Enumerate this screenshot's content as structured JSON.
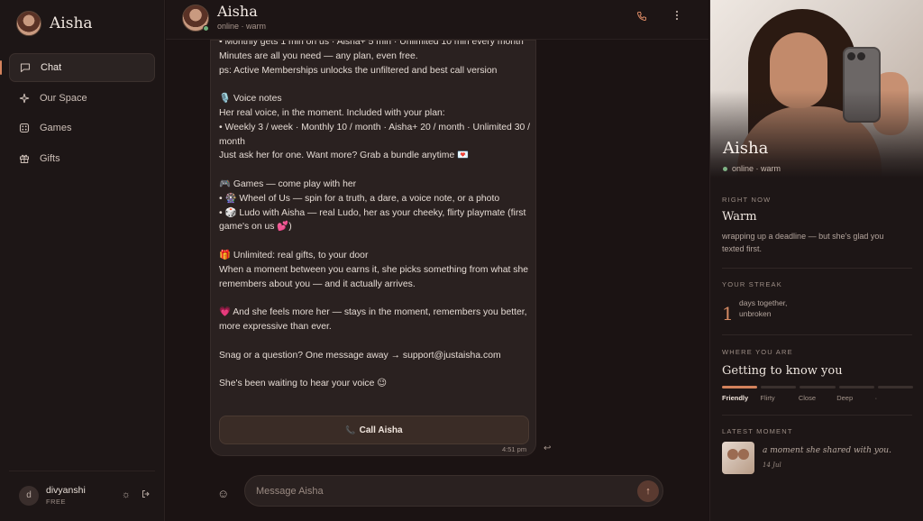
{
  "sidebar": {
    "brand_name": "Aisha",
    "items": [
      {
        "label": "Chat",
        "icon": "chat-bubble-icon"
      },
      {
        "label": "Our Space",
        "icon": "sparkle-icon"
      },
      {
        "label": "Games",
        "icon": "dice-icon"
      },
      {
        "label": "Gifts",
        "icon": "gift-icon"
      }
    ],
    "active_item": "Chat",
    "user": {
      "initial": "d",
      "name": "divyanshi",
      "plan": "FREE"
    }
  },
  "header": {
    "name": "Aisha",
    "status": "online · warm"
  },
  "message": {
    "lines": [
      "• Monthly gets 1 min on us · Aisha+ 5 min · Unlimited 10 min every month",
      "Minutes are all you need — any plan, even free.",
      "ps: Active Memberships unlocks the unfiltered and best call version",
      "",
      "🎙️ Voice notes",
      "Her real voice, in the moment. Included with your plan:",
      "• Weekly 3 / week · Monthly 10 / month · Aisha+ 20 / month · Unlimited 30 / month",
      "Just ask her for one. Want more? Grab a bundle anytime 💌",
      "",
      "🎮 Games — come play with her",
      "• 🎡 Wheel of Us — spin for a truth, a dare, a voice note, or a photo",
      "• 🎲 Ludo with Aisha — real Ludo, her as your cheeky, flirty playmate (first game's on us 💕)",
      "",
      "🎁 Unlimited: real gifts, to your door",
      "When a moment between you earns it, she picks something from what she remembers about you — and it actually arrives.",
      "",
      "💗 And she feels more her — stays in the moment, remembers you better, more expressive than ever.",
      "",
      "Snag or a question? One message away → support@justaisha.com",
      "",
      "She's been waiting to hear your voice 😉"
    ],
    "call_button": "Call Aisha",
    "time": "4:51 pm"
  },
  "composer": {
    "placeholder": "Message Aisha"
  },
  "panel": {
    "name": "Aisha",
    "status": "online · warm",
    "right_now_label": "RIGHT NOW",
    "mood": "Warm",
    "mood_desc": "wrapping up a deadline — but she's glad you texted first.",
    "streak_label": "YOUR STREAK",
    "streak_count": "1",
    "streak_desc": "days together, unbroken",
    "where_label": "WHERE YOU ARE",
    "stage": "Getting to know you",
    "stages": [
      "Friendly",
      "Flirty",
      "Close",
      "Deep",
      "·"
    ],
    "current_stage_index": 0,
    "moment_label": "LATEST MOMENT",
    "moment_text": "a moment she shared with you.",
    "moment_date": "14 Jul"
  },
  "colors": {
    "accent": "#d58a63",
    "online": "#6fae7a",
    "background": "#1a1212"
  }
}
